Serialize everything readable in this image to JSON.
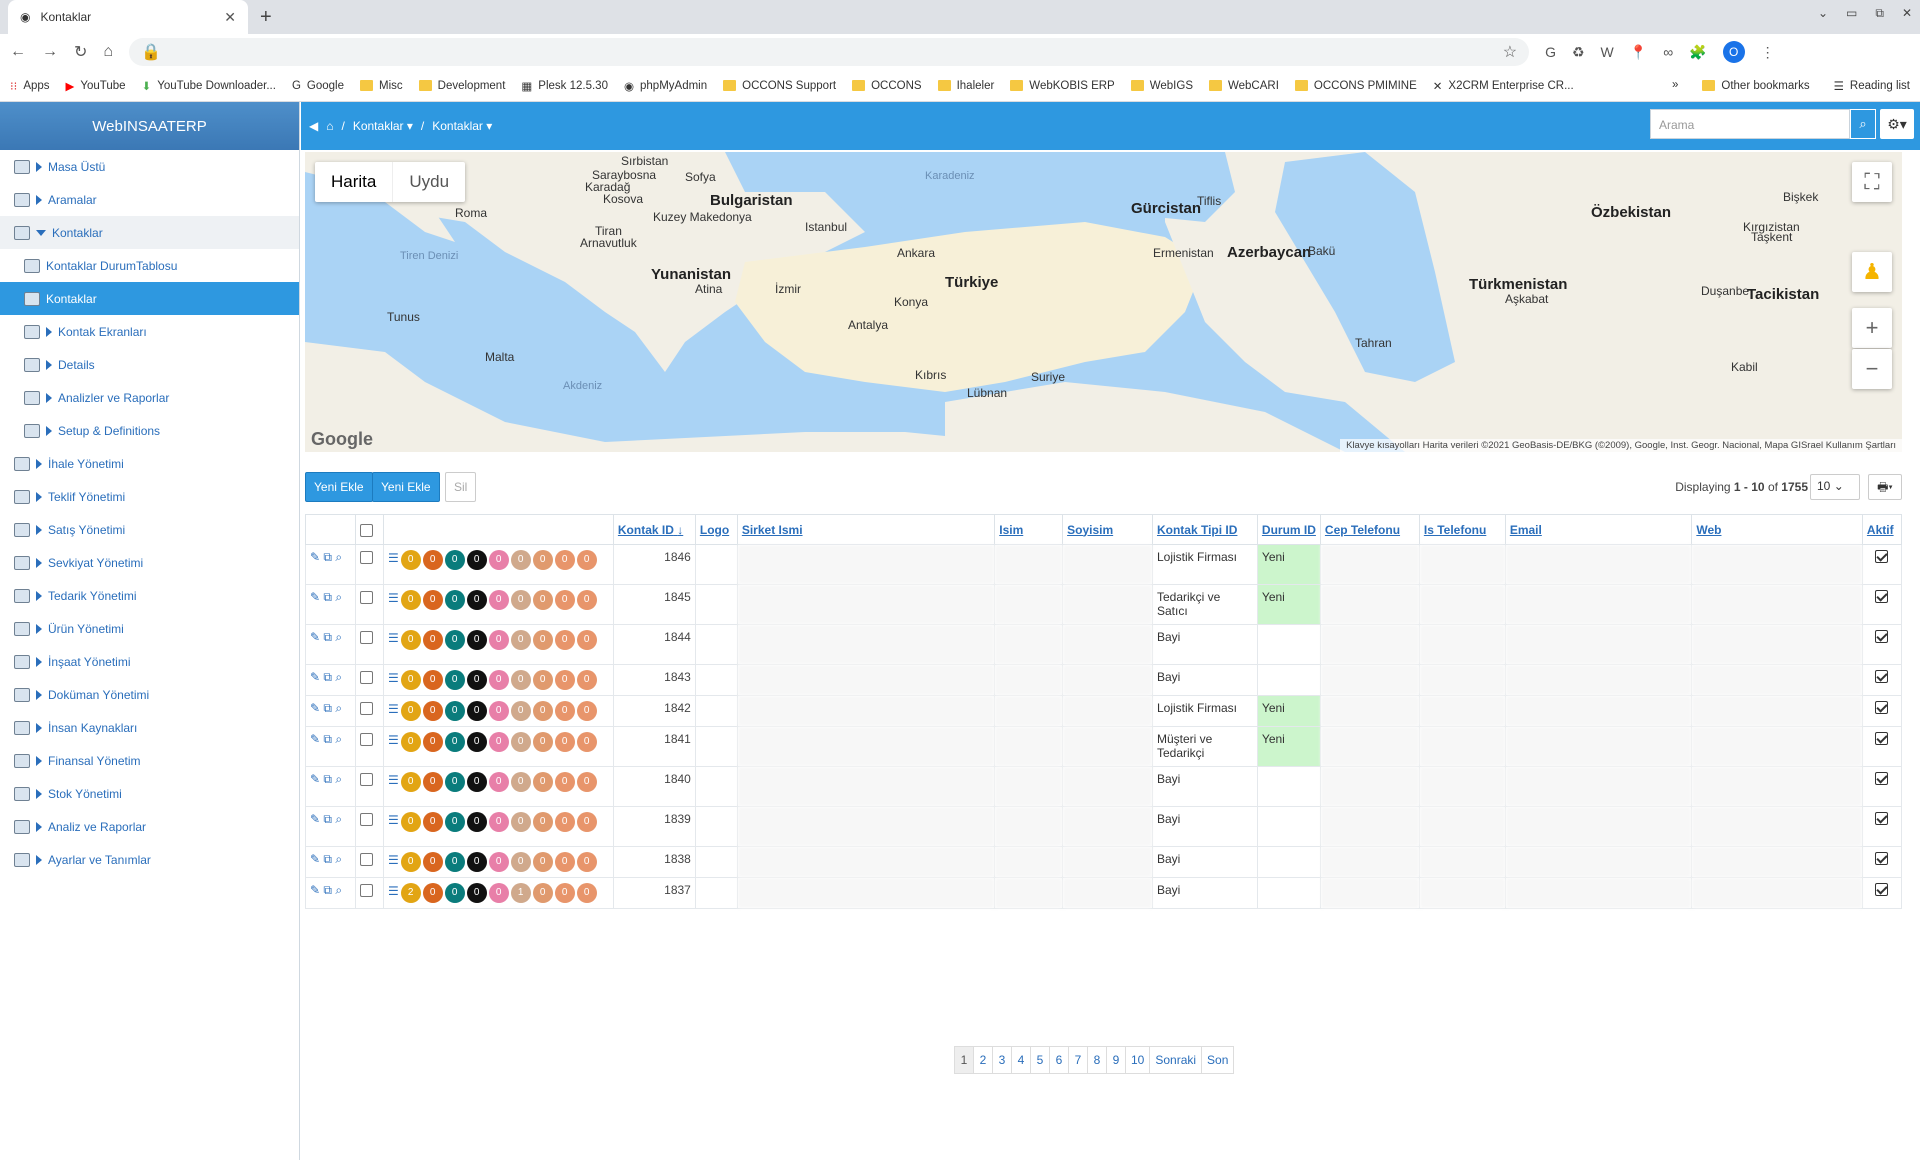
{
  "browser": {
    "tab_title": "Kontaklar",
    "bookmarks": [
      "Apps",
      "YouTube",
      "YouTube Downloader...",
      "Google",
      "Misc",
      "Development",
      "Plesk 12.5.30",
      "phpMyAdmin",
      "OCCONS Support",
      "OCCONS",
      "Ihaleler",
      "WebKOBIS ERP",
      "WebIGS",
      "WebCARI",
      "OCCONS PMIMINE",
      "X2CRM Enterprise CR..."
    ],
    "other_bookmarks": "Other bookmarks",
    "reading_list": "Reading list",
    "avatar_letter": "O"
  },
  "sidebar": {
    "brand": "WebINSAATERP",
    "items": [
      {
        "label": "Masa Üstü",
        "level": 0,
        "state": ""
      },
      {
        "label": "Aramalar",
        "level": 0,
        "state": ""
      },
      {
        "label": "Kontaklar",
        "level": 0,
        "state": "open"
      },
      {
        "label": "Kontaklar DurumTablosu",
        "level": 1,
        "state": ""
      },
      {
        "label": "Kontaklar",
        "level": 1,
        "state": "active"
      },
      {
        "label": "Kontak Ekranları",
        "level": 1,
        "state": ""
      },
      {
        "label": "Details",
        "level": 1,
        "state": ""
      },
      {
        "label": "Analizler ve Raporlar",
        "level": 1,
        "state": ""
      },
      {
        "label": "Setup & Definitions",
        "level": 1,
        "state": ""
      },
      {
        "label": "İhale Yönetimi",
        "level": 0,
        "state": ""
      },
      {
        "label": "Teklif Yönetimi",
        "level": 0,
        "state": ""
      },
      {
        "label": "Satış Yönetimi",
        "level": 0,
        "state": ""
      },
      {
        "label": "Sevkiyat Yönetimi",
        "level": 0,
        "state": ""
      },
      {
        "label": "Tedarik Yönetimi",
        "level": 0,
        "state": ""
      },
      {
        "label": "Ürün Yönetimi",
        "level": 0,
        "state": ""
      },
      {
        "label": "İnşaat Yönetimi",
        "level": 0,
        "state": ""
      },
      {
        "label": "Doküman Yönetimi",
        "level": 0,
        "state": ""
      },
      {
        "label": "İnsan Kaynakları",
        "level": 0,
        "state": ""
      },
      {
        "label": "Finansal Yönetim",
        "level": 0,
        "state": ""
      },
      {
        "label": "Stok Yönetimi",
        "level": 0,
        "state": ""
      },
      {
        "label": "Analiz ve Raporlar",
        "level": 0,
        "state": ""
      },
      {
        "label": "Ayarlar ve Tanımlar",
        "level": 0,
        "state": ""
      }
    ]
  },
  "header": {
    "breadcrumb_1": "Kontaklar",
    "breadcrumb_2": "Kontaklar",
    "search_placeholder": "Arama"
  },
  "map": {
    "toggle_map": "Harita",
    "toggle_sat": "Uydu",
    "labels": [
      "Sırbistan",
      "Saraybosna",
      "Sofya",
      "Karadağ",
      "Bulgaristan",
      "Kosova",
      "Kuzey Makedonya",
      "Tiran",
      "Arnavutluk",
      "Istanbul",
      "Karadeniz",
      "Gürcistan",
      "Tiflis",
      "Ermenistan",
      "Azerbaycan",
      "Bakü",
      "Özbekistan",
      "Kırgızistan",
      "Taşkent",
      "Tiren Denizi",
      "Yunanistan",
      "Atina",
      "İzmir",
      "Ankara",
      "Türkiye",
      "Konya",
      "Antalya",
      "Türkmenistan",
      "Aşkabat",
      "Duşanbe",
      "Tacikistan",
      "Tunus",
      "Malta",
      "Akdeniz",
      "Kıbrıs",
      "Lübnan",
      "Suriye",
      "Tahran",
      "Kabil",
      "Roma",
      "Bişkek"
    ],
    "credits": "Klavye kısayolları   Harita verileri ©2021 GeoBasis-DE/BKG (©2009), Google, Inst. Geogr. Nacional, Mapa GISrael   Kullanım Şartları",
    "logo": "Google"
  },
  "grid": {
    "btn_add_1": "Yeni Ekle",
    "btn_add_2": "Yeni Ekle",
    "btn_delete": "Sil",
    "displaying_prefix": "Displaying ",
    "displaying_range": "1 - 10",
    "displaying_of": " of ",
    "displaying_total": "1755",
    "page_size": "10",
    "columns": [
      "Kontak ID",
      "Logo",
      "Sirket Ismi",
      "Isim",
      "Soyisim",
      "Kontak Tipi ID",
      "Durum ID",
      "Cep Telefonu",
      "Is Telefonu",
      "Email",
      "Web",
      "Aktif"
    ],
    "badge_colors": [
      "#e2a514",
      "#d9661f",
      "#0a7c7c",
      "#111111",
      "#e87fa8",
      "#d0a98c",
      "#e09a6e",
      "#e8956b",
      "#e8956b"
    ],
    "rows": [
      {
        "id": "1846",
        "tip": "Lojistik Firması",
        "durum": "Yeni",
        "badges": [
          "0",
          "0",
          "0",
          "0",
          "0",
          "0",
          "0",
          "0",
          "0"
        ]
      },
      {
        "id": "1845",
        "tip": "Tedarikçi ve Satıcı",
        "durum": "Yeni",
        "badges": [
          "0",
          "0",
          "0",
          "0",
          "0",
          "0",
          "0",
          "0",
          "0"
        ]
      },
      {
        "id": "1844",
        "tip": "Bayi",
        "durum": "",
        "badges": [
          "0",
          "0",
          "0",
          "0",
          "0",
          "0",
          "0",
          "0",
          "0"
        ]
      },
      {
        "id": "1843",
        "tip": "Bayi",
        "durum": "",
        "badges": [
          "0",
          "0",
          "0",
          "0",
          "0",
          "0",
          "0",
          "0",
          "0"
        ]
      },
      {
        "id": "1842",
        "tip": "Lojistik Firması",
        "durum": "Yeni",
        "badges": [
          "0",
          "0",
          "0",
          "0",
          "0",
          "0",
          "0",
          "0",
          "0"
        ]
      },
      {
        "id": "1841",
        "tip": "Müşteri ve Tedarikçi",
        "durum": "Yeni",
        "badges": [
          "0",
          "0",
          "0",
          "0",
          "0",
          "0",
          "0",
          "0",
          "0"
        ]
      },
      {
        "id": "1840",
        "tip": "Bayi",
        "durum": "",
        "badges": [
          "0",
          "0",
          "0",
          "0",
          "0",
          "0",
          "0",
          "0",
          "0"
        ]
      },
      {
        "id": "1839",
        "tip": "Bayi",
        "durum": "",
        "badges": [
          "0",
          "0",
          "0",
          "0",
          "0",
          "0",
          "0",
          "0",
          "0"
        ]
      },
      {
        "id": "1838",
        "tip": "Bayi",
        "durum": "",
        "badges": [
          "0",
          "0",
          "0",
          "0",
          "0",
          "0",
          "0",
          "0",
          "0"
        ]
      },
      {
        "id": "1837",
        "tip": "Bayi",
        "durum": "",
        "badges": [
          "2",
          "0",
          "0",
          "0",
          "0",
          "1",
          "0",
          "0",
          "0"
        ]
      }
    ]
  },
  "pager": {
    "pages": [
      "1",
      "2",
      "3",
      "4",
      "5",
      "6",
      "7",
      "8",
      "9",
      "10"
    ],
    "next": "Sonraki",
    "last": "Son"
  }
}
